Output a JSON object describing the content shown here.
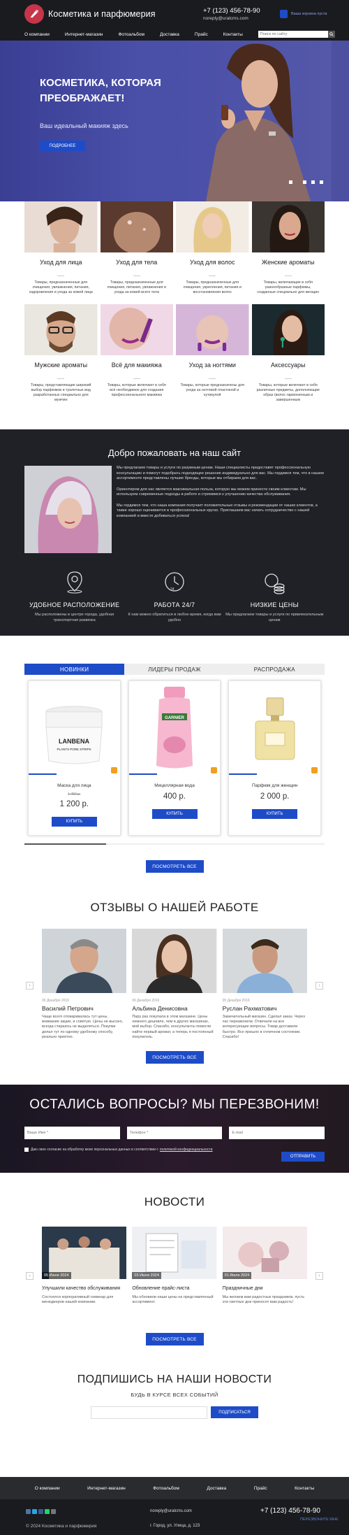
{
  "header": {
    "site_title": "Косметика и парфюмерия",
    "phone": "+7 (123) 456-78-90",
    "email": "noreply@uralcms.com",
    "cart_label": "Ваша корзина пуста",
    "search_placeholder": "Поиск по сайту",
    "nav": [
      "О компании",
      "Интернет-магазин",
      "Фотоальбом",
      "Доставка",
      "Прайс",
      "Контакты"
    ]
  },
  "hero": {
    "title": "КОСМЕТИКА, КОТОРАЯ ПРЕОБРАЖАЕТ!",
    "subtitle": "Ваш идеальный макияж здесь",
    "button": "ПОДРОБНЕЕ"
  },
  "categories": [
    {
      "title": "Уход для лица",
      "desc": "Товары, предназначенные для очищения, увлажнения, питания, оздоровления и ухода за кожей лица"
    },
    {
      "title": "Уход для тела",
      "desc": "Товары, предназначенные для очищения, питания, увлажнения и ухода за кожей всего тела"
    },
    {
      "title": "Уход для волос",
      "desc": "Товары, предназначенные для очищения, укрепления, питания и восстановления волос"
    },
    {
      "title": "Женские ароматы",
      "desc": "Товары, включающие в себя разнообразные парфюмы, созданные специально для женщин"
    },
    {
      "title": "Мужские ароматы",
      "desc": "Товары, представляющие широкий выбор парфюмов и туалетных вод разработанных специально для мужчин"
    },
    {
      "title": "Всё для макияжа",
      "desc": "Товары, которые включают в себя всё необходимое для создания профессионального макияжа"
    },
    {
      "title": "Уход за ногтями",
      "desc": "Товары, которые предназначены для ухода за ногтевой пластиной и кутикулой"
    },
    {
      "title": "Аксессуары",
      "desc": "Товары, которые включают в себя различные предметы, дополняющие образ (волос гармоничным и завершенным"
    }
  ],
  "about": {
    "title": "Добро пожаловать на наш сайт",
    "p1": "Мы предлагаем товары и услуги по разумным ценам. Наши специалисты предоставят профессиональную консультацию и помогут подобрать подходящее решение индивидуально для вас. Мы гордимся тем, что в нашем ассортименте представлены лучшие бренды, которые мы отбираем для вас.",
    "p2": "Ориентиром для нас является максимальная польза, которую мы можем принести своим клиентам. Мы используем современные подходы в работе и стремимся к улучшению качества обслуживания.",
    "p3": "Мы гордимся тем, что наша компания получает положительные отзывы и рекомендации от наших клиентов, а также хорошо оценивается в профессиональных кругах. Приглашаем вас начать сотрудничество с нашей компанией и вместе добиваться успеха!",
    "features": [
      {
        "title": "УДОБНОЕ РАСПОЛОЖЕНИЕ",
        "desc": "Мы расположены в центре города, удобная транспортная развязка"
      },
      {
        "title": "РАБОТА 24/7",
        "desc": "К нам можно обратиться в любое время, когда вам удобно"
      },
      {
        "title": "НИЗКИЕ ЦЕНЫ",
        "desc": "Мы предлагаем товары и услуги по привлекательным ценам"
      }
    ]
  },
  "product_tabs": [
    "НОВИНКИ",
    "ЛИДЕРЫ ПРОДАЖ",
    "РАСПРОДАЖА"
  ],
  "products": [
    {
      "name": "Маска для лица",
      "old_price": "1 450 р.",
      "price": "1 200 р.",
      "button": "КУПИТЬ",
      "brand": "LANBENA",
      "subtitle": "PLANTS PORE STRIPS"
    },
    {
      "name": "Мицеллярная вода",
      "old_price": "",
      "price": "400 р.",
      "button": "КУПИТЬ",
      "brand": "GARNIER",
      "subtitle": ""
    },
    {
      "name": "Парфюм для женщин",
      "old_price": "",
      "price": "2 000 р.",
      "button": "КУПИТЬ",
      "brand": "",
      "subtitle": ""
    }
  ],
  "show_all": "ПОСМОТРЕТЬ ВСЕ",
  "reviews": {
    "title": "ОТЗЫВЫ О НАШЕЙ РАБОТЕ",
    "items": [
      {
        "date": "06 Декабря 2016",
        "name": "Василий Петрович",
        "text": "Чаще всего отоваривалась тут цены, внимание акции, и советую. Цены не высоко, всегда стараюсь не выделяться. Покупки делал тут по одному удобному способу, реально приятно."
      },
      {
        "date": "06 Декабря 2016",
        "name": "Альбина Денисовна",
        "text": "Пару раз покупала в этом магазине. Цены немного дешевле, чем в других магазинах, мой выбор. Спасибо, консультанты помогли найти первый аромат, а теперь я постоянный покупатель."
      },
      {
        "date": "05 Декабря 2016",
        "name": "Руслан Рахматович",
        "text": "Замечательный магазин. Сделал заказ. Через час перезвонили. Отвечали на все интересующие вопросы. Товар доставили быстро. Все пришло в отличном состоянии. Спасибо!"
      }
    ],
    "button": "ПОСМОТРЕТЬ ВСЕ"
  },
  "callback": {
    "title": "ОСТАЛИСЬ ВОПРОСЫ? МЫ ПЕРЕЗВОНИМ!",
    "name_placeholder": "Ваше Имя *",
    "phone_placeholder": "Телефон *",
    "email_placeholder": "E-mail",
    "agree_text": "Даю свое согласие на обработку моих персональных данных в соответствии с",
    "agree_link": "политикой конфиденциальности",
    "button": "ОТПРАВИТЬ"
  },
  "news": {
    "title": "НОВОСТИ",
    "items": [
      {
        "date": "05 Июля 2024",
        "title": "Улучшили качество обслуживания",
        "text": "Состоялся корпоративный семинар для менеджеров нашей компании."
      },
      {
        "date": "03 Июля 2024",
        "title": "Обновление прайс-листа",
        "text": "Мы обновили наши цены на представленный ассортимент."
      },
      {
        "date": "01 Июля 2024",
        "title": "Праздничные дни",
        "text": "Мы желаем вам радостных праздников, пусть эти светлые дни приносят вам радость!"
      }
    ],
    "button": "ПОСМОТРЕТЬ ВСЕ"
  },
  "subscribe": {
    "title": "ПОДПИШИСЬ НА НАШИ НОВОСТИ",
    "subtitle": "БУДЬ В КУРСЕ ВСЕХ СОБЫТИЙ",
    "button": "ПОДПИСАТЬСЯ"
  },
  "footer": {
    "nav": [
      "О компании",
      "Интернет-магазин",
      "Фотоальбом",
      "Доставка",
      "Прайс",
      "Контакты"
    ],
    "copyright": "© 2024 Косметика и парфюмерия",
    "email": "noreply@uralcms.com",
    "address": "г. Город, ул. Улица, д. 123",
    "phone": "+7 (123) 456-78-90",
    "pay_label": "ПЕРЕЗВОНИТЕ МНЕ"
  },
  "colors": {
    "accent": "#1e4cc8",
    "dark": "#1a1b1f",
    "logo": "#c6354a"
  }
}
